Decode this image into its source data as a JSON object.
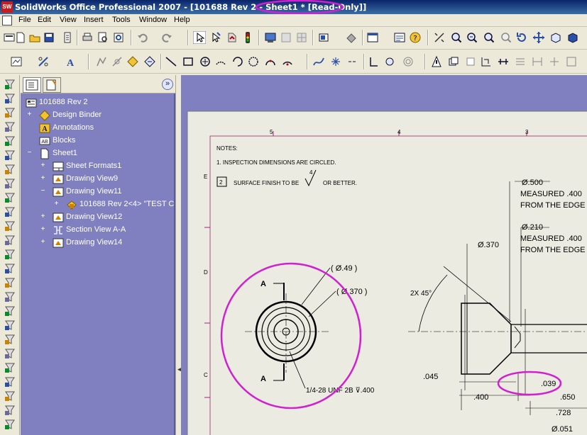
{
  "window": {
    "title_prefix": "SolidWorks Office Professional 2007 - [101688 Rev 2 - Sheet1 *",
    "title_readonly": "[Read-Only]]",
    "app_icon": "SW"
  },
  "menu": [
    "File",
    "Edit",
    "View",
    "Insert",
    "Tools",
    "Window",
    "Help"
  ],
  "feature_manager": {
    "tabs": [
      "feature-tree-tab",
      "property-tab"
    ],
    "root": "101688 Rev 2",
    "items": [
      {
        "label": "Design Binder",
        "icon": "design-binder-icon",
        "expander": "+"
      },
      {
        "label": "Annotations",
        "icon": "annotations-icon",
        "expander": ""
      },
      {
        "label": "Blocks",
        "icon": "blocks-icon",
        "expander": ""
      },
      {
        "label": "Sheet1",
        "icon": "sheet-icon",
        "expander": "−"
      },
      {
        "label": "Sheet Formats1",
        "icon": "sheet-format-icon",
        "expander": "+"
      },
      {
        "label": "Drawing View9",
        "icon": "drawing-view-icon",
        "expander": "+"
      },
      {
        "label": "Drawing View11",
        "icon": "drawing-view-icon",
        "expander": "−"
      },
      {
        "label": "101688 Rev 2<4> \"TEST C",
        "icon": "part-icon",
        "expander": "+"
      },
      {
        "label": "Drawing View12",
        "icon": "drawing-view-icon",
        "expander": "+"
      },
      {
        "label": "Section View A-A",
        "icon": "section-view-icon",
        "expander": "+"
      },
      {
        "label": "Drawing View14",
        "icon": "drawing-view-icon",
        "expander": "+"
      }
    ]
  },
  "drawing": {
    "zone_cols": [
      "5",
      "4",
      "3"
    ],
    "zone_rows": [
      "E",
      "D",
      "C"
    ],
    "notes_title": "NOTES:",
    "note1": "1. INSPECTION DIMENSIONS ARE CIRCLED.",
    "note2_num": "2",
    "note2_text_a": "SURFACE FINISH TO BE",
    "note2_text_b": "OR BETTER.",
    "surface_value": "4",
    "dim_d49": "( Ø.49 )",
    "dim_d370_paren": "( Ø.370 )",
    "section_label_top": "A",
    "section_label_bottom": "A",
    "thread_callout": "1/4-28 UNF 2B ⊽.400",
    "chamfer": "2X 45°",
    "dim_d370": "Ø.370",
    "dim_d500": "Ø.500",
    "measured1": "MEASURED .400",
    "from_edge1": "FROM THE EDGE",
    "dim_d210": "Ø.210",
    "measured2": "MEASURED .400",
    "from_edge2": "FROM THE EDGE",
    "dim_045": ".045",
    "dim_039": ".039",
    "dim_400": ".400",
    "dim_650": ".650",
    "dim_728": ".728",
    "dim_051": "Ø.051"
  },
  "colors": {
    "highlight": "#d020d0",
    "panel_bg": "#8080c0",
    "sheet_bg": "#ebebe1",
    "title_bar_start": "#0a246a"
  }
}
